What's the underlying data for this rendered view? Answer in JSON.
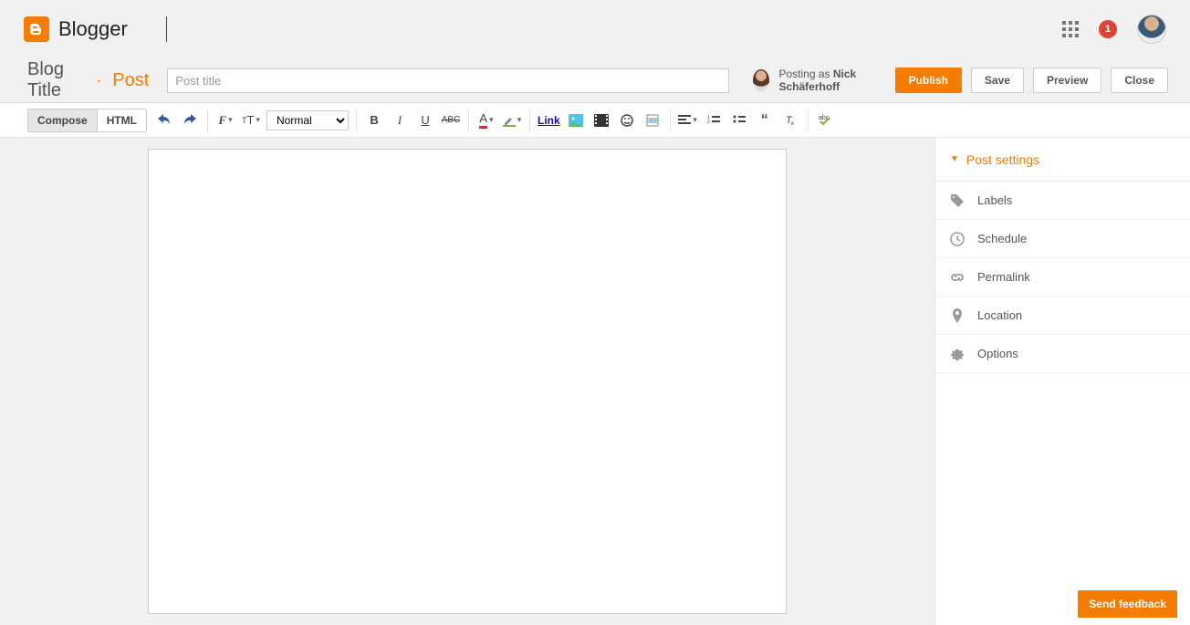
{
  "header": {
    "brand": "Blogger",
    "notifications_count": "1"
  },
  "subheader": {
    "blog_title": "Blog Title",
    "separator": "·",
    "post_word": "Post",
    "title_placeholder": "Post title",
    "posting_as_prefix": "Posting as ",
    "posting_as_name": "Nick Schäferhoff",
    "buttons": {
      "publish": "Publish",
      "save": "Save",
      "preview": "Preview",
      "close": "Close"
    }
  },
  "toolbar": {
    "mode_tabs": {
      "compose": "Compose",
      "html": "HTML"
    },
    "format_select": "Normal",
    "link_label": "Link"
  },
  "sidebar": {
    "header": "Post settings",
    "items": [
      {
        "label": "Labels",
        "icon": "tag"
      },
      {
        "label": "Schedule",
        "icon": "clock"
      },
      {
        "label": "Permalink",
        "icon": "link"
      },
      {
        "label": "Location",
        "icon": "pin"
      },
      {
        "label": "Options",
        "icon": "gear"
      }
    ]
  },
  "feedback": "Send feedback"
}
